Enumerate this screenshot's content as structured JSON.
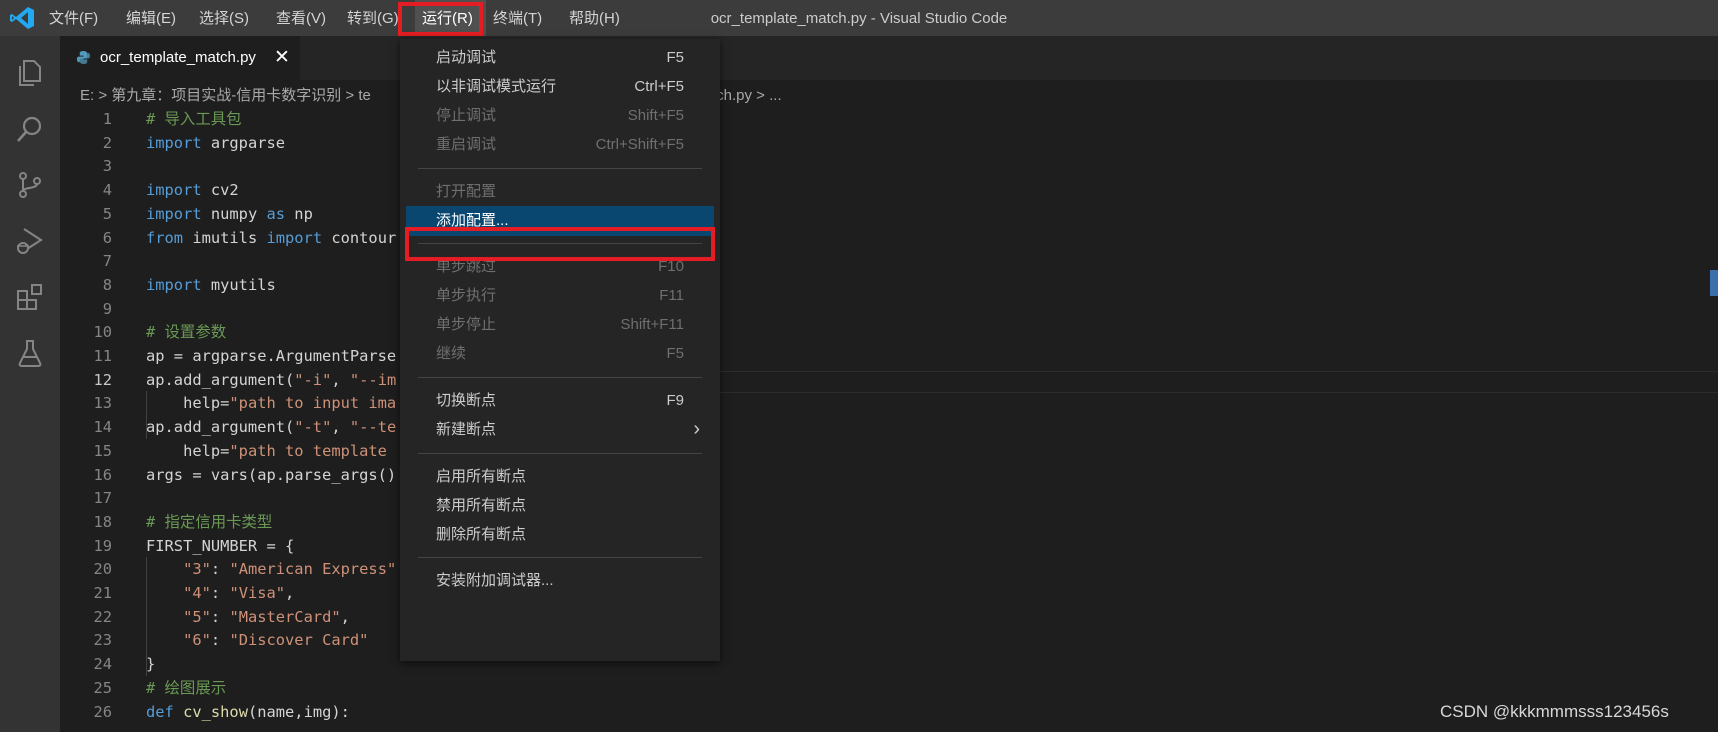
{
  "window_title": "ocr_template_match.py - Visual Studio Code",
  "menubar": [
    {
      "label": "文件(F)"
    },
    {
      "label": "编辑(E)"
    },
    {
      "label": "选择(S)"
    },
    {
      "label": "查看(V)"
    },
    {
      "label": "转到(G)"
    },
    {
      "label": "运行(R)"
    },
    {
      "label": "终端(T)"
    },
    {
      "label": "帮助(H)"
    }
  ],
  "activity_icons": [
    "explorer-icon",
    "search-icon",
    "source-control-icon",
    "run-debug-icon",
    "extensions-icon",
    "testing-icon"
  ],
  "tab": {
    "label": "ocr_template_match.py",
    "close": "✕"
  },
  "breadcrumb": {
    "left": "E: > 第九章：项目实战-信用卡数字识别 > te",
    "right": "tch.py > ..."
  },
  "run_menu": [
    {
      "label": "启动调试",
      "shortcut": "F5",
      "state": "enabled"
    },
    {
      "label": "以非调试模式运行",
      "shortcut": "Ctrl+F5",
      "state": "enabled"
    },
    {
      "label": "停止调试",
      "shortcut": "Shift+F5",
      "state": "disabled"
    },
    {
      "label": "重启调试",
      "shortcut": "Ctrl+Shift+F5",
      "state": "disabled"
    },
    {
      "label": "打开配置",
      "shortcut": "",
      "state": "disabled"
    },
    {
      "label": "添加配置...",
      "shortcut": "",
      "state": "selected"
    },
    {
      "label": "单步跳过",
      "shortcut": "F10",
      "state": "disabled"
    },
    {
      "label": "单步执行",
      "shortcut": "F11",
      "state": "disabled"
    },
    {
      "label": "单步停止",
      "shortcut": "Shift+F11",
      "state": "disabled"
    },
    {
      "label": "继续",
      "shortcut": "F5",
      "state": "disabled"
    },
    {
      "label": "切换断点",
      "shortcut": "F9",
      "state": "enabled"
    },
    {
      "label": "新建断点",
      "shortcut": "",
      "state": "enabled"
    },
    {
      "label": "启用所有断点",
      "shortcut": "",
      "state": "enabled"
    },
    {
      "label": "禁用所有断点",
      "shortcut": "",
      "state": "enabled"
    },
    {
      "label": "删除所有断点",
      "shortcut": "",
      "state": "enabled"
    },
    {
      "label": "安装附加调试器...",
      "shortcut": "",
      "state": "enabled"
    }
  ],
  "submenu_arrow": "›",
  "current_line": 12,
  "code_lines": [
    {
      "n": "1",
      "tokens": [
        [
          "cm",
          "# 导入工具包"
        ]
      ]
    },
    {
      "n": "2",
      "tokens": [
        [
          "kw",
          "import"
        ],
        [
          "id",
          " argparse"
        ]
      ]
    },
    {
      "n": "3",
      "tokens": []
    },
    {
      "n": "4",
      "tokens": [
        [
          "kw",
          "import"
        ],
        [
          "id",
          " cv2"
        ]
      ]
    },
    {
      "n": "5",
      "tokens": [
        [
          "kw",
          "import"
        ],
        [
          "id",
          " numpy "
        ],
        [
          "kw",
          "as"
        ],
        [
          "id",
          " np"
        ]
      ]
    },
    {
      "n": "6",
      "tokens": [
        [
          "kw",
          "from"
        ],
        [
          "id",
          " imutils "
        ],
        [
          "kw",
          "import"
        ],
        [
          "id",
          " contour"
        ]
      ]
    },
    {
      "n": "7",
      "tokens": []
    },
    {
      "n": "8",
      "tokens": [
        [
          "kw",
          "import"
        ],
        [
          "id",
          " myutils"
        ]
      ]
    },
    {
      "n": "9",
      "tokens": []
    },
    {
      "n": "10",
      "tokens": [
        [
          "cm",
          "# 设置参数"
        ]
      ]
    },
    {
      "n": "11",
      "tokens": [
        [
          "id",
          "ap = argparse.ArgumentParse"
        ]
      ]
    },
    {
      "n": "12",
      "tokens": [
        [
          "id",
          "ap.add_argument("
        ],
        [
          "str",
          "\"-i\""
        ],
        [
          "id",
          ", "
        ],
        [
          "str",
          "\"--im"
        ]
      ]
    },
    {
      "n": "13",
      "tokens": [
        [
          "id",
          "    help="
        ],
        [
          "str",
          "\"path to input ima"
        ]
      ]
    },
    {
      "n": "14",
      "tokens": [
        [
          "id",
          "ap.add_argument("
        ],
        [
          "str",
          "\"-t\""
        ],
        [
          "id",
          ", "
        ],
        [
          "str",
          "\"--te"
        ]
      ]
    },
    {
      "n": "15",
      "tokens": [
        [
          "id",
          "    help="
        ],
        [
          "str",
          "\"path to template"
        ]
      ]
    },
    {
      "n": "16",
      "tokens": [
        [
          "id",
          "args = vars(ap.parse_args()"
        ]
      ]
    },
    {
      "n": "17",
      "tokens": []
    },
    {
      "n": "18",
      "tokens": [
        [
          "cm",
          "# 指定信用卡类型"
        ]
      ]
    },
    {
      "n": "19",
      "tokens": [
        [
          "id",
          "FIRST_NUMBER = {"
        ]
      ]
    },
    {
      "n": "20",
      "tokens": [
        [
          "id",
          "    "
        ],
        [
          "str",
          "\"3\""
        ],
        [
          "id",
          ": "
        ],
        [
          "str",
          "\"American Express\""
        ]
      ]
    },
    {
      "n": "21",
      "tokens": [
        [
          "id",
          "    "
        ],
        [
          "str",
          "\"4\""
        ],
        [
          "id",
          ": "
        ],
        [
          "str",
          "\"Visa\""
        ],
        [
          "id",
          ","
        ]
      ]
    },
    {
      "n": "22",
      "tokens": [
        [
          "id",
          "    "
        ],
        [
          "str",
          "\"5\""
        ],
        [
          "id",
          ": "
        ],
        [
          "str",
          "\"MasterCard\""
        ],
        [
          "id",
          ","
        ]
      ]
    },
    {
      "n": "23",
      "tokens": [
        [
          "id",
          "    "
        ],
        [
          "str",
          "\"6\""
        ],
        [
          "id",
          ": "
        ],
        [
          "str",
          "\"Discover Card\""
        ]
      ]
    },
    {
      "n": "24",
      "tokens": [
        [
          "id",
          "}"
        ]
      ]
    },
    {
      "n": "25",
      "tokens": [
        [
          "cm",
          "# 绘图展示"
        ]
      ]
    },
    {
      "n": "26",
      "tokens": [
        [
          "kw",
          "def"
        ],
        [
          "id",
          " "
        ],
        [
          "fn",
          "cv_show"
        ],
        [
          "id",
          "(name,img):"
        ]
      ]
    }
  ],
  "watermark": "CSDN @kkkmmmsss123456s",
  "colors": {
    "highlight_box": "#e31d23",
    "selected_item": "#094771",
    "accent_logo": "#23a9f2"
  }
}
